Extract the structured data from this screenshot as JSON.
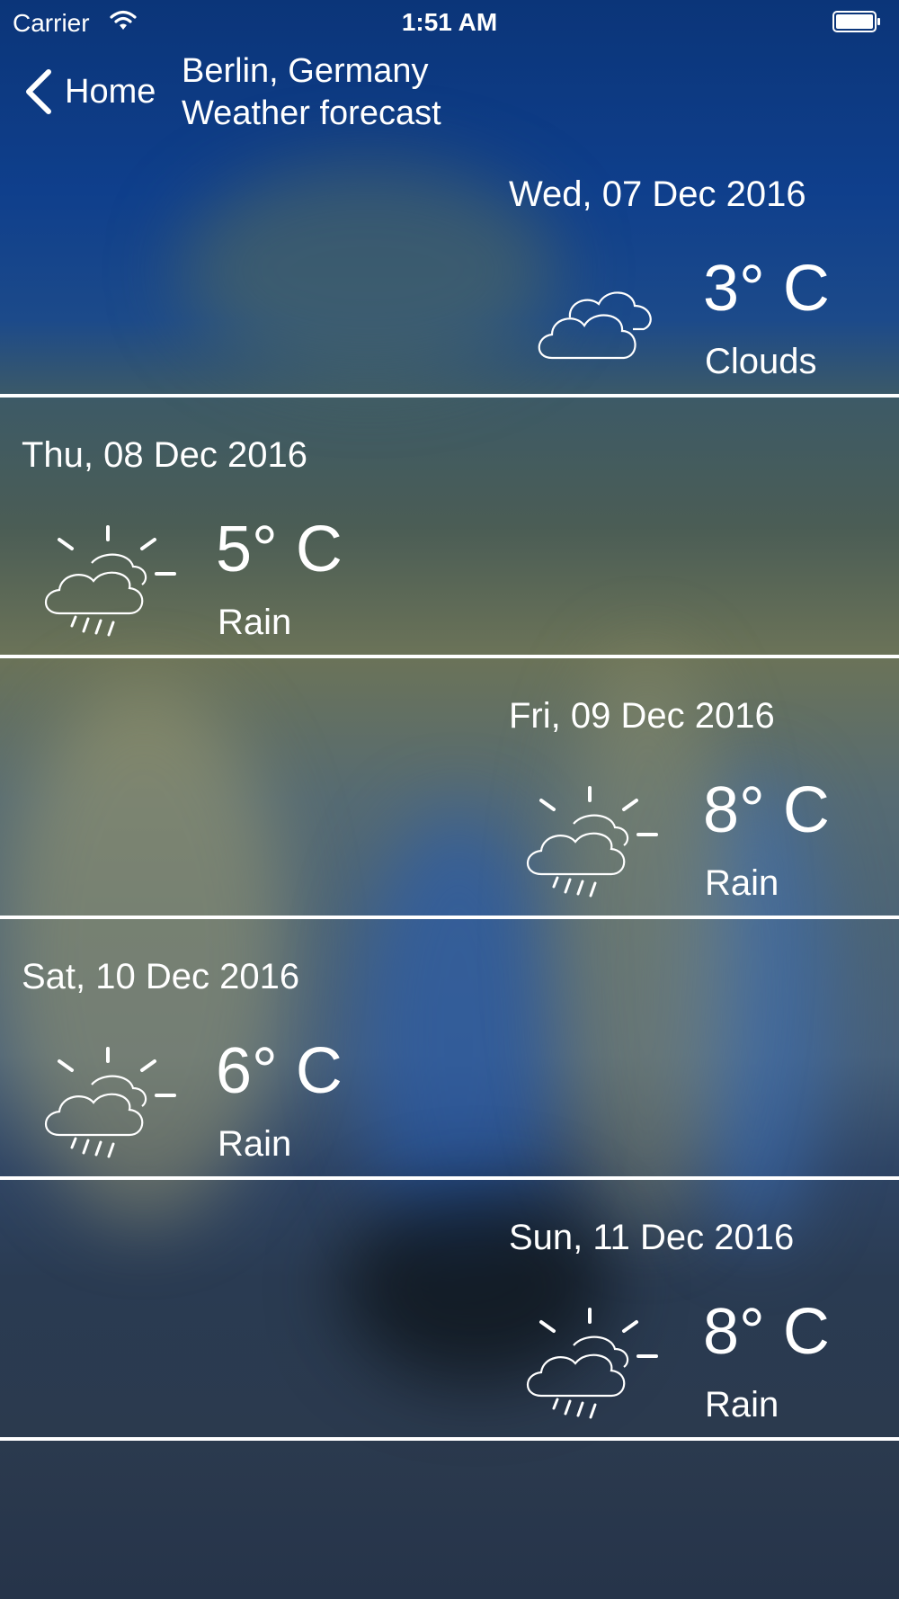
{
  "status_bar": {
    "carrier": "Carrier",
    "time": "1:51 AM"
  },
  "nav": {
    "back_label": "Home",
    "title_line1": "Berlin, Germany",
    "title_line2": "Weather forecast"
  },
  "forecast": [
    {
      "date": "Wed, 07 Dec 2016",
      "temp": "3° C",
      "condition": "Clouds",
      "icon": "cloud-icon"
    },
    {
      "date": "Thu, 08 Dec 2016",
      "temp": "5° C",
      "condition": "Rain",
      "icon": "sun-cloud-rain-icon"
    },
    {
      "date": "Fri, 09 Dec 2016",
      "temp": "8° C",
      "condition": "Rain",
      "icon": "sun-cloud-rain-icon"
    },
    {
      "date": "Sat, 10 Dec 2016",
      "temp": "6° C",
      "condition": "Rain",
      "icon": "sun-cloud-rain-icon"
    },
    {
      "date": "Sun, 11 Dec 2016",
      "temp": "8° C",
      "condition": "Rain",
      "icon": "sun-cloud-rain-icon"
    }
  ],
  "colors": {
    "sky_top": "#0b3579",
    "text": "#ffffff",
    "divider": "#ffffff"
  }
}
